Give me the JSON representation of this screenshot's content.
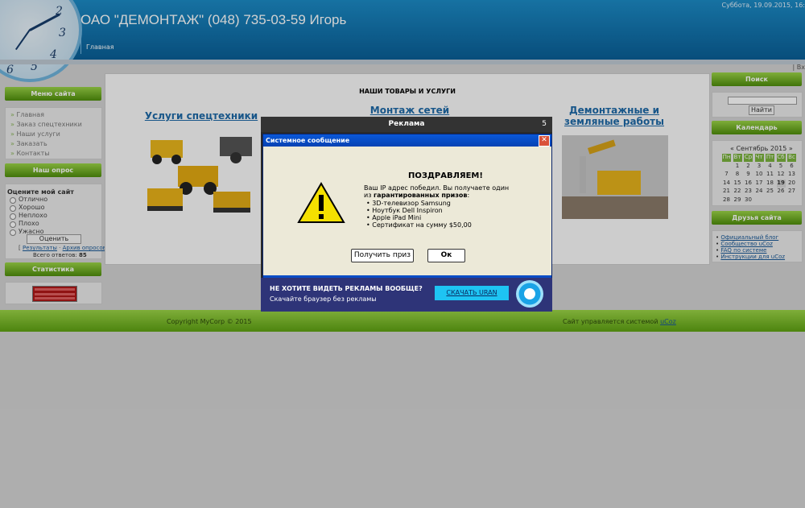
{
  "header": {
    "title": "ОАО \"ДЕМОНТАЖ\" (048) 735-03-59 Игорь",
    "date": "Суббота, 19.09.2015, 16:",
    "nav_home": "Главная",
    "clock_numbers": [
      "2",
      "3",
      "4",
      "5",
      "6"
    ]
  },
  "top_right_link": "Вх",
  "left_sidebar": {
    "menu_title": "Меню сайта",
    "menu_items": [
      "Главная",
      "Заказ спецтехники",
      "Наши услуги",
      "Заказать",
      "Контакты"
    ],
    "poll_title": "Наш опрос",
    "poll_question": "Оцените мой сайт",
    "poll_options": [
      "Отлично",
      "Хорошо",
      "Неплохо",
      "Плохо",
      "Ужасно"
    ],
    "poll_button": "Оценить",
    "poll_results_link": "Результаты",
    "poll_archive_link": "Архив опросов",
    "poll_total_label": "Всего ответов:",
    "poll_total_value": "85",
    "stats_title": "Статистика"
  },
  "content": {
    "title": "НАШИ ТОВАРЫ И УСЛУГИ",
    "services": [
      "Услуги спецтехники",
      "Монтаж сетей водопровода",
      "Демонтажные и земляные работы"
    ]
  },
  "right_sidebar": {
    "search_title": "Поиск",
    "search_button": "Найти",
    "search_value": "",
    "calendar_title": "Календарь",
    "calendar_month": "« Сентябрь 2015 »",
    "calendar_days": [
      "Пн",
      "Вт",
      "Ср",
      "Чт",
      "Пт",
      "Сб",
      "Вс"
    ],
    "calendar_weeks": [
      [
        "",
        "1",
        "2",
        "3",
        "4",
        "5",
        "6"
      ],
      [
        "7",
        "8",
        "9",
        "10",
        "11",
        "12",
        "13"
      ],
      [
        "14",
        "15",
        "16",
        "17",
        "18",
        "19",
        "20"
      ],
      [
        "21",
        "22",
        "23",
        "24",
        "25",
        "26",
        "27"
      ],
      [
        "28",
        "29",
        "30",
        "",
        "",
        "",
        ""
      ]
    ],
    "calendar_today": "19",
    "friends_title": "Друзья сайта",
    "friends_links": [
      "Официальный блог",
      "Сообщество uCoz",
      "FAQ по системе",
      "Инструкции для uCoz"
    ]
  },
  "footer": {
    "copyright": "Copyright MyCorp © 2015",
    "powered_text": "Сайт управляется системой",
    "powered_link": "uCoz"
  },
  "ad": {
    "title": "Реклама",
    "timer": "5",
    "dialog_title": "Системное сообщение",
    "close_glyph": "✕",
    "heading": "ПОЗДРАВЛЯЕМ!",
    "line1": "Ваш IP адрес победил. Вы получаете один",
    "line2_prefix": "из ",
    "line2_bold": "гарантированных призов",
    "line2_suffix": ":",
    "prizes": [
      "• 3D-телевизор Samsung",
      "• Ноутбук Dell Inspiron",
      "• Apple iPad Mini",
      "• Сертификат на сумму $50,00"
    ],
    "get_prize_button": "Получить приз",
    "ok_button": "Ок",
    "bottom_question": "НЕ ХОТИТЕ ВИДЕТЬ РЕКЛАМЫ ВООБЩЕ?",
    "bottom_sub": "Скачайте браузер без рекламы",
    "download_button": "СКАЧАТЬ URAN"
  }
}
